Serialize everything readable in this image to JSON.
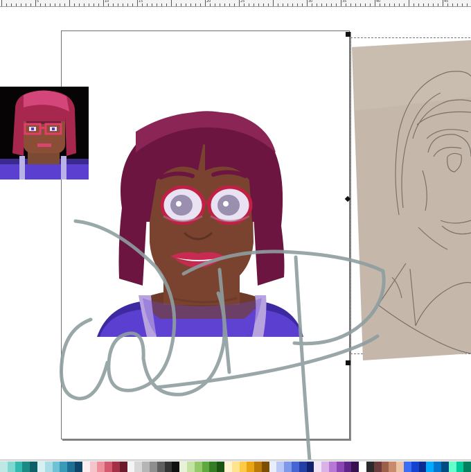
{
  "ruler": {
    "labels": [
      "",
      "5",
      "",
      "10",
      "15",
      "",
      "20",
      "25",
      "",
      "30",
      "35",
      "40",
      "",
      "45"
    ]
  },
  "artboard": {
    "sprite_label": "",
    "signature": "wip"
  },
  "palette": {
    "swatches": [
      "#bfe8e4",
      "#7fd8cf",
      "#33b9ae",
      "#1a8a82",
      "#0f5f66",
      "#d9f0f2",
      "#a8dde6",
      "#6fc1d3",
      "#3a9bb8",
      "#1d6f95",
      "#0c4568",
      "#fdeff0",
      "#f6c5cc",
      "#ee8f9e",
      "#d35a6e",
      "#a43048",
      "#6a1a2c",
      "#f4f4f4",
      "#d7d7d7",
      "#b5b5b5",
      "#8e8e8e",
      "#5f5f5f",
      "#343434",
      "#101010",
      "#e7f2d9",
      "#c4e2a1",
      "#93c96b",
      "#5ea83f",
      "#357d25",
      "#1b5314",
      "#fff4cf",
      "#ffe38d",
      "#ffcb46",
      "#e8a514",
      "#b97a07",
      "#7c4f03",
      "#e8eefc",
      "#b9c8f6",
      "#7f99ea",
      "#4866d3",
      "#243fa5",
      "#10226a",
      "#f2e4f7",
      "#d9b3e8",
      "#b678d4",
      "#8c45b4",
      "#5f2487",
      "#36104f",
      "#ffffff",
      "#2a2a2a",
      "#6b3c3c",
      "#9b5f4a",
      "#c78a6a",
      "#ecc3a3",
      "#3b6ef5",
      "#1543d1",
      "#0b2c8f",
      "#00aaff",
      "#0077cc",
      "#004c80",
      "#66ffcc",
      "#00cc99",
      "#00805f"
    ]
  }
}
